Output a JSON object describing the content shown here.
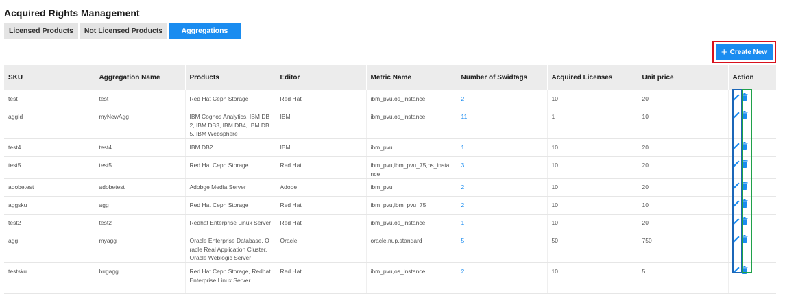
{
  "page": {
    "title": "Acquired Rights Management"
  },
  "tabs": [
    {
      "label": "Licensed Products",
      "active": false
    },
    {
      "label": "Not Licensed Products",
      "active": false
    },
    {
      "label": "Aggregations",
      "active": true
    }
  ],
  "toolbar": {
    "create_label": "Create New",
    "create_icon": "plus-icon"
  },
  "table": {
    "columns": [
      "SKU",
      "Aggregation Name",
      "Products",
      "Editor",
      "Metric Name",
      "Number of Swidtags",
      "Acquired Licenses",
      "Unit price",
      "Action"
    ],
    "rows": [
      {
        "sku": "test",
        "name": "test",
        "products": "Red Hat Ceph Storage",
        "editor": "Red Hat",
        "metric": "ibm_pvu,os_instance",
        "swidtags": "2",
        "licenses": "10",
        "price": "20"
      },
      {
        "sku": "aggId",
        "name": "myNewAgg",
        "products": "IBM Cognos Analytics, IBM DB2, IBM DB3, IBM DB4, IBM DB5, IBM Websphere",
        "editor": "IBM",
        "metric": "ibm_pvu,os_instance",
        "swidtags": "11",
        "licenses": "1",
        "price": "10"
      },
      {
        "sku": "test4",
        "name": "test4",
        "products": "IBM DB2",
        "editor": "IBM",
        "metric": "ibm_pvu",
        "swidtags": "1",
        "licenses": "10",
        "price": "20"
      },
      {
        "sku": "test5",
        "name": "test5",
        "products": "Red Hat Ceph Storage",
        "editor": "Red Hat",
        "metric": "ibm_pvu,ibm_pvu_75,os_instance",
        "swidtags": "3",
        "licenses": "10",
        "price": "20"
      },
      {
        "sku": "adobetest",
        "name": "adobetest",
        "products": "Adobge Media Server",
        "editor": "Adobe",
        "metric": "ibm_pvu",
        "swidtags": "2",
        "licenses": "10",
        "price": "20"
      },
      {
        "sku": "aggsku",
        "name": "agg",
        "products": "Red Hat Ceph Storage",
        "editor": "Red Hat",
        "metric": "ibm_pvu,ibm_pvu_75",
        "swidtags": "2",
        "licenses": "10",
        "price": "10"
      },
      {
        "sku": "test2",
        "name": "test2",
        "products": "Redhat Enterprise Linux Server",
        "editor": "Red Hat",
        "metric": "ibm_pvu,os_instance",
        "swidtags": "1",
        "licenses": "10",
        "price": "20"
      },
      {
        "sku": "agg",
        "name": "myagg",
        "products": "Oracle Enterprise Database, Oracle Real Application Cluster, Oracle Weblogic Server",
        "editor": "Oracle",
        "metric": "oracle.nup.standard",
        "swidtags": "5",
        "licenses": "50",
        "price": "750"
      },
      {
        "sku": "testsku",
        "name": "bugagg",
        "products": "Red Hat Ceph Storage, Redhat Enterprise Linux Server",
        "editor": "Red Hat",
        "metric": "ibm_pvu,os_instance",
        "swidtags": "2",
        "licenses": "10",
        "price": "5"
      }
    ]
  },
  "colors": {
    "accent": "#1a8cf0",
    "highlight_red": "#d8111c",
    "highlight_blue": "#1b66b7",
    "highlight_green": "#1fa14a"
  },
  "icons": {
    "edit": "pencil-icon",
    "delete": "trash-icon"
  }
}
